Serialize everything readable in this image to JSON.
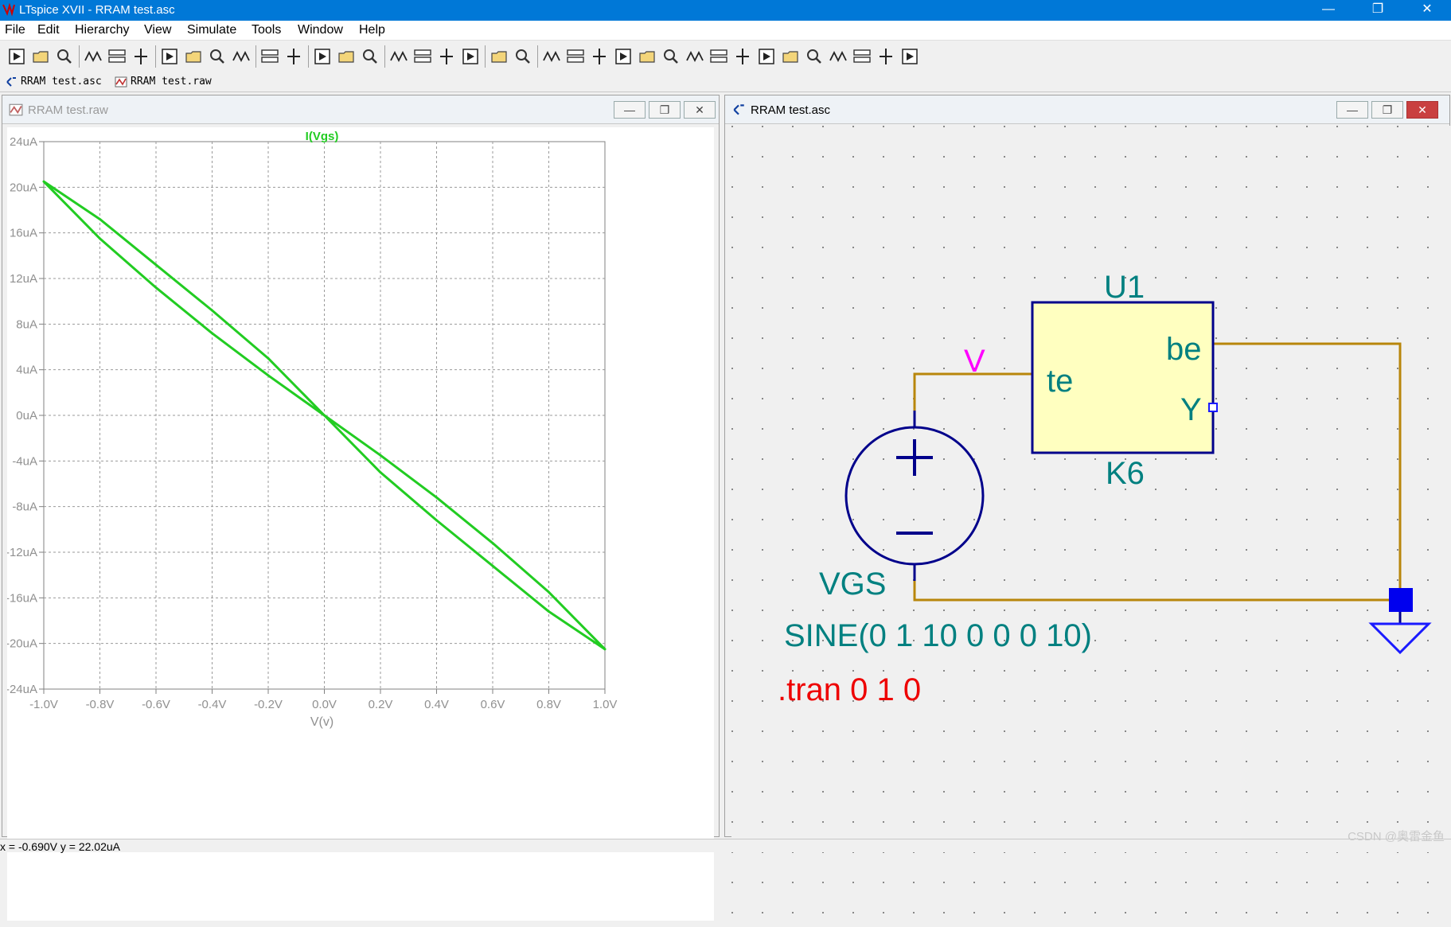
{
  "window": {
    "title": "LTspice XVII - RRAM test.asc",
    "controls": {
      "minimize": "—",
      "maximize": "❐",
      "close": "✕"
    }
  },
  "menu": [
    "File",
    "Edit",
    "Hierarchy",
    "View",
    "Simulate",
    "Tools",
    "Window",
    "Help"
  ],
  "toolbar_icons": [
    "run-icon",
    "open-icon",
    "save-icon",
    "control-panel-icon",
    "halt-icon",
    "pan-icon",
    "zoom-in-icon",
    "zoom-area-icon",
    "zoom-out-icon",
    "zoom-cancel-icon",
    "autorange-icon",
    "erase-icon",
    "tile-horizontal-icon",
    "tile-vertical-icon",
    "cascade-icon",
    "cut-icon",
    "copy-icon",
    "paste-icon",
    "find-icon",
    "print-setup-icon",
    "print-icon",
    "wire-icon",
    "ground-icon",
    "label-icon",
    "resistor-icon",
    "capacitor-icon",
    "inductor-icon",
    "diode-icon",
    "component-icon",
    "move-icon",
    "drag-icon",
    "undo-icon",
    "redo-icon",
    "rotate-icon",
    "mirror-icon",
    "text-icon",
    "spice-directive-icon"
  ],
  "tabs": [
    {
      "label": "RRAM test.asc",
      "icon": "schematic-icon"
    },
    {
      "label": "RRAM test.raw",
      "icon": "waveform-icon"
    }
  ],
  "plot_window": {
    "title": "RRAM test.raw",
    "controls": {
      "minimize": "—",
      "maximize": "❐",
      "close": "✕"
    }
  },
  "schematic_window": {
    "title": "RRAM test.asc",
    "controls": {
      "minimize": "—",
      "maximize": "❐",
      "close": "✕"
    }
  },
  "chart_data": {
    "type": "line",
    "title": "I(Vgs)",
    "xlabel": "V(v)",
    "ylabel": "",
    "xlim": [
      -1.0,
      1.0
    ],
    "ylim": [
      -24,
      24
    ],
    "x_ticks": [
      "-1.0V",
      "-0.8V",
      "-0.6V",
      "-0.4V",
      "-0.2V",
      "0.0V",
      "0.2V",
      "0.4V",
      "0.6V",
      "0.8V",
      "1.0V"
    ],
    "y_ticks": [
      "24uA",
      "20uA",
      "16uA",
      "12uA",
      "8uA",
      "4uA",
      "0uA",
      "-4uA",
      "-8uA",
      "-12uA",
      "-16uA",
      "-20uA",
      "-24uA"
    ],
    "grid": true,
    "series": [
      {
        "name": "I(Vgs)",
        "color": "#22cc22",
        "x": [
          0.0,
          0.2,
          0.4,
          0.6,
          0.8,
          1.0,
          0.8,
          0.6,
          0.4,
          0.2,
          0.0,
          -0.2,
          -0.4,
          -0.6,
          -0.8,
          -1.0,
          -0.8,
          -0.6,
          -0.4,
          -0.2,
          0.0
        ],
        "y": [
          0,
          -3.5,
          -7.2,
          -11.2,
          -15.5,
          -20.5,
          -17.2,
          -13.2,
          -9.2,
          -5.0,
          0,
          3.5,
          7.2,
          11.2,
          15.5,
          20.5,
          17.2,
          13.2,
          9.2,
          5.0,
          0
        ]
      }
    ]
  },
  "schematic": {
    "component_ref": "U1",
    "component_value": "K6",
    "pin_te": "te",
    "pin_be": "be",
    "pin_y": "Y",
    "net_label": "V",
    "source_name": "VGS",
    "source_value": "SINE(0 1 10 0 0 0 10)",
    "directive": ".tran 0 1 0"
  },
  "status": "x = -0.690V    y = 22.02uA",
  "watermark": "CSDN @奥雷金鱼"
}
